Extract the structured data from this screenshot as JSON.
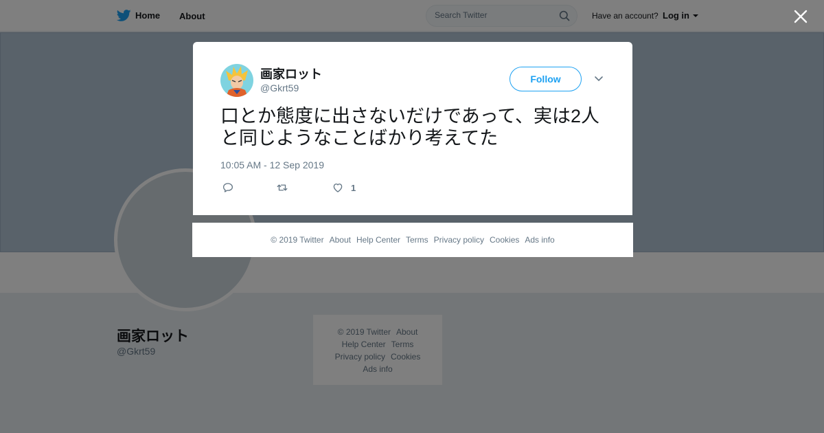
{
  "topbar": {
    "home_label": "Home",
    "about_label": "About",
    "search_placeholder": "Search Twitter",
    "account_prompt": "Have an account?",
    "login_label": "Log in"
  },
  "profile": {
    "name": "画家ロット",
    "handle": "@Gkrt59"
  },
  "side_footer": {
    "copyright": "© 2019 Twitter",
    "about": "About",
    "help": "Help Center",
    "terms": "Terms",
    "privacy": "Privacy policy",
    "cookies": "Cookies",
    "ads": "Ads info"
  },
  "tweet": {
    "author_name": "画家ロット",
    "author_handle": "@Gkrt59",
    "follow_label": "Follow",
    "text": "口とか態度に出さないだけであって、実は2人と同じようなことばかり考えてた",
    "timestamp": "10:05 AM - 12 Sep 2019",
    "like_count": "1"
  },
  "modal_footer": {
    "copyright": "© 2019 Twitter",
    "about": "About",
    "help": "Help Center",
    "terms": "Terms",
    "privacy": "Privacy policy",
    "cookies": "Cookies",
    "ads": "Ads info"
  },
  "colors": {
    "brand": "#1da1f2",
    "text_primary": "#14171a",
    "text_secondary": "#657786",
    "banner": "#b3c4d4",
    "background": "#e6ecf0"
  },
  "icons": [
    "twitter-bird-icon",
    "search-icon",
    "close-icon",
    "chevron-down-icon",
    "reply-icon",
    "retweet-icon",
    "heart-icon"
  ]
}
